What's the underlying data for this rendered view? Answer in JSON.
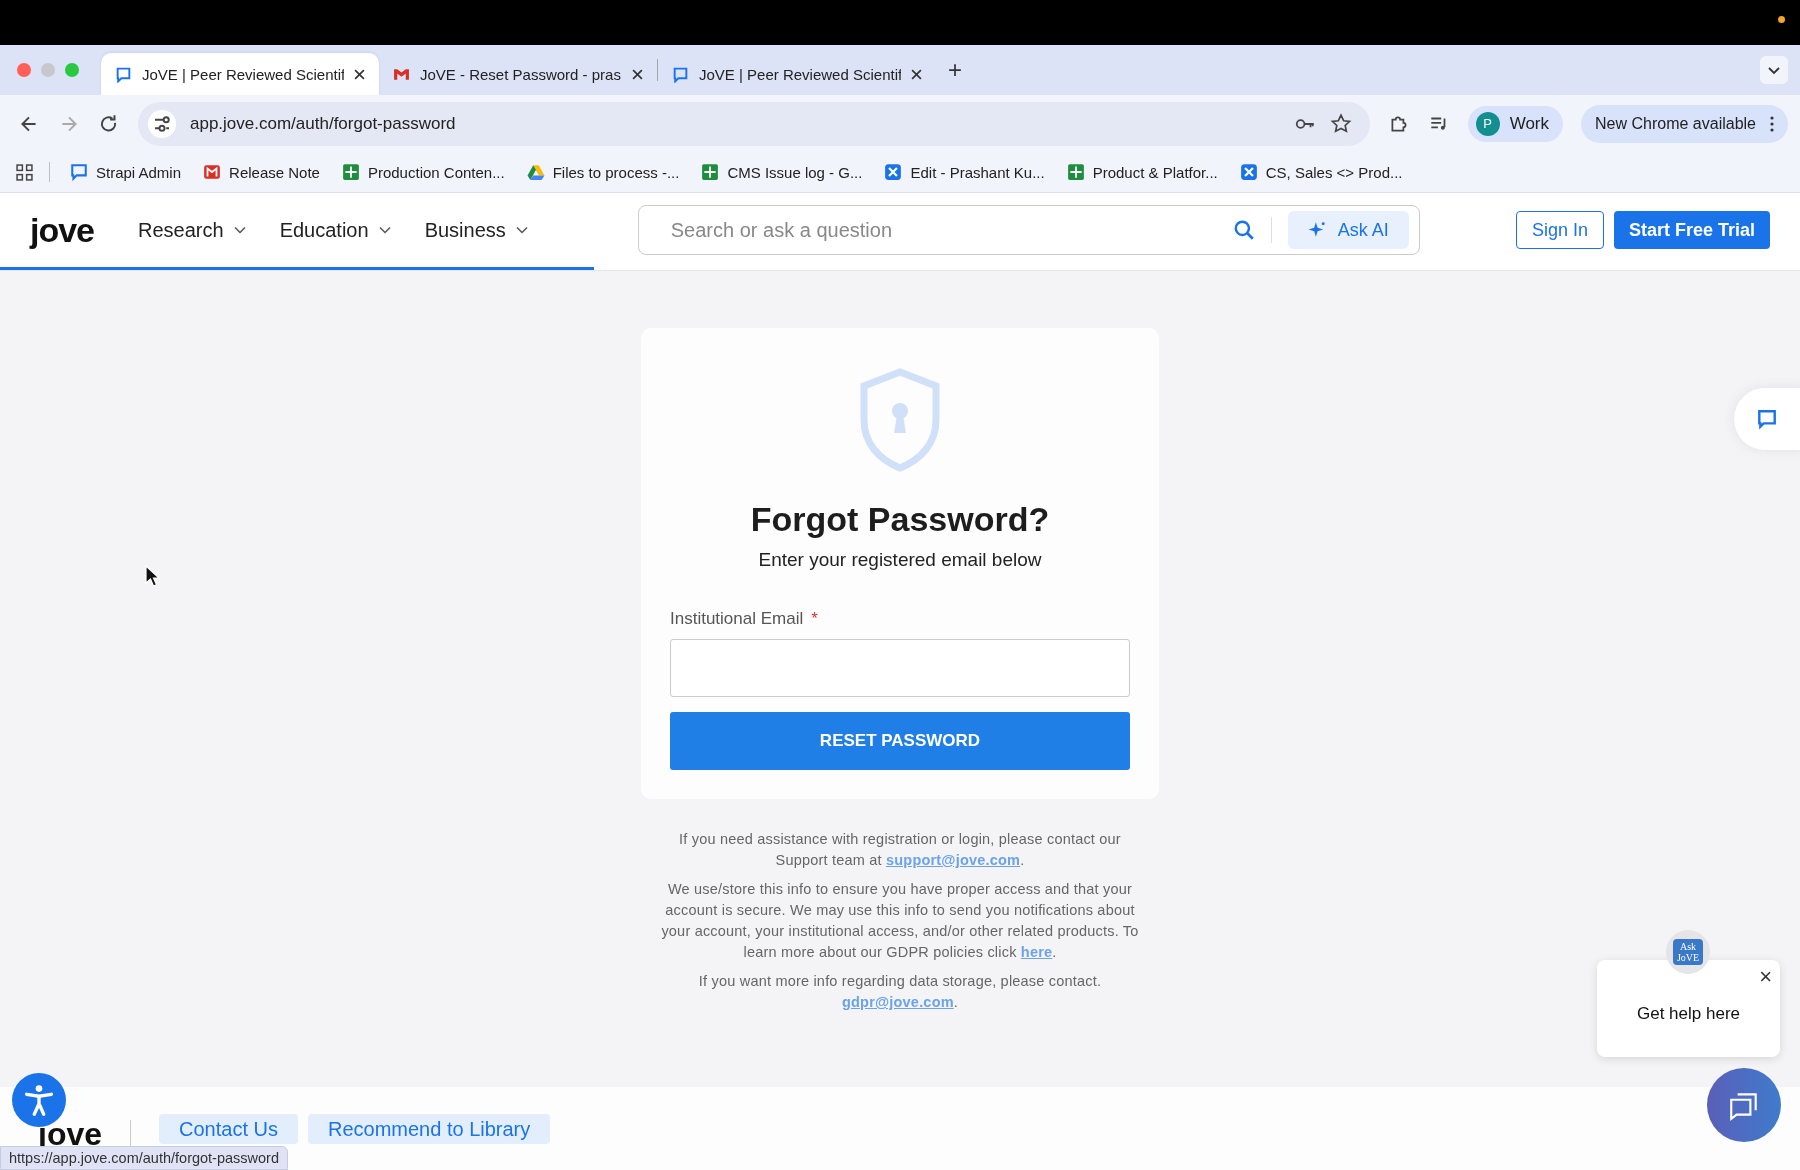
{
  "browser": {
    "tabs": [
      {
        "title": "JoVE | Peer Reviewed Scientif",
        "kind": "chat",
        "selected": true
      },
      {
        "title": "JoVE - Reset Password - pras",
        "kind": "mail",
        "selected": false
      },
      {
        "title": "JoVE | Peer Reviewed Scientif",
        "kind": "chat",
        "selected": false
      }
    ],
    "new_tab": "+",
    "address": "app.jove.com/auth/forgot-password",
    "profile": {
      "initial": "P",
      "label": "Work"
    },
    "update_button": "New Chrome available",
    "bookmarks": [
      {
        "label": "Strapi Admin",
        "kind": "chat"
      },
      {
        "label": "Release Note",
        "kind": "mail"
      },
      {
        "label": "Production Conten...",
        "kind": "sheet"
      },
      {
        "label": "Files to process -...",
        "kind": "drive"
      },
      {
        "label": "CMS Issue log - G...",
        "kind": "sheet"
      },
      {
        "label": "Edit - Prashant Ku...",
        "kind": "cross"
      },
      {
        "label": "Product & Platfor...",
        "kind": "sheet"
      },
      {
        "label": "CS, Sales <> Prod...",
        "kind": "cross"
      }
    ],
    "status_url": "https://app.jove.com/auth/forgot-password"
  },
  "site": {
    "logo": "jove",
    "menu": [
      "Research",
      "Education",
      "Business"
    ],
    "search": {
      "placeholder": "Search or ask a question"
    },
    "ask_ai": "Ask AI",
    "sign_in": "Sign In",
    "trial": "Start Free Trial",
    "loading": {
      "level": 0.33
    }
  },
  "card": {
    "title": "Forgot Password?",
    "subtitle": "Enter your registered email below",
    "field": {
      "label": "Institutional Email",
      "required_mark": "*"
    },
    "submit": "RESET PASSWORD"
  },
  "notes": [
    {
      "text": "If you need assistance with registration or login, please contact our Support team at",
      "link": "support@jove.com",
      "end": "."
    },
    {
      "text": "We use/store this info to ensure you have proper access and that your account is secure. We may use this info to send you notifications about your account, your institutional access, and/or other related products. To learn more about our GDPR policies click",
      "link": "here",
      "end": "."
    },
    {
      "text": "If you want more info regarding data storage, please contact.",
      "link": "gdpr@jove.com",
      "end": "."
    }
  ],
  "help": {
    "badge": "Ask JoVE",
    "text": "Get help here",
    "close": "×"
  },
  "footer": {
    "logo": "jove",
    "buttons": [
      "Contact Us",
      "Recommend to Library"
    ]
  }
}
